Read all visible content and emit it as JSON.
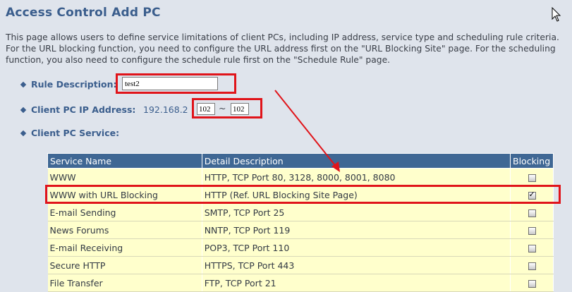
{
  "page": {
    "title": "Access Control Add PC",
    "intro": "This page allows users to define service limitations of client PCs, including IP address, service type and scheduling rule criteria. For the URL blocking function, you need to configure the URL address first on the \"URL Blocking Site\" page. For the scheduling function, you also need to configure the schedule rule first on the \"Schedule Rule\" page."
  },
  "form": {
    "rule_label": "Rule Description:",
    "rule_value": "test2",
    "ip_label": "Client PC IP Address:",
    "ip_prefix": "192.168.2",
    "ip_from": "102",
    "ip_sep": "~",
    "ip_to": "102",
    "service_label": "Client PC Service:"
  },
  "table": {
    "headers": [
      "Service Name",
      "Detail Description",
      "Blocking"
    ],
    "rows": [
      {
        "name": "WWW",
        "desc": "HTTP, TCP Port 80, 3128, 8000, 8001, 8080",
        "blocked": false
      },
      {
        "name": "WWW with URL Blocking",
        "desc": "HTTP (Ref. URL Blocking Site Page)",
        "blocked": true
      },
      {
        "name": "E-mail Sending",
        "desc": "SMTP, TCP Port 25",
        "blocked": false
      },
      {
        "name": "News Forums",
        "desc": "NNTP, TCP Port 119",
        "blocked": false
      },
      {
        "name": "E-mail Receiving",
        "desc": "POP3, TCP Port 110",
        "blocked": false
      },
      {
        "name": "Secure HTTP",
        "desc": "HTTPS, TCP Port 443",
        "blocked": false
      },
      {
        "name": "File Transfer",
        "desc": "FTP, TCP Port 21",
        "blocked": false
      }
    ]
  },
  "colors": {
    "accent": "#3b5e8d",
    "header_bg": "#3f6794",
    "row_bg": "#ffffcc",
    "annotation_red": "#e0141a"
  },
  "icons": {
    "cursor": "mouse-pointer-icon",
    "checkbox": "checkbox-icon"
  }
}
